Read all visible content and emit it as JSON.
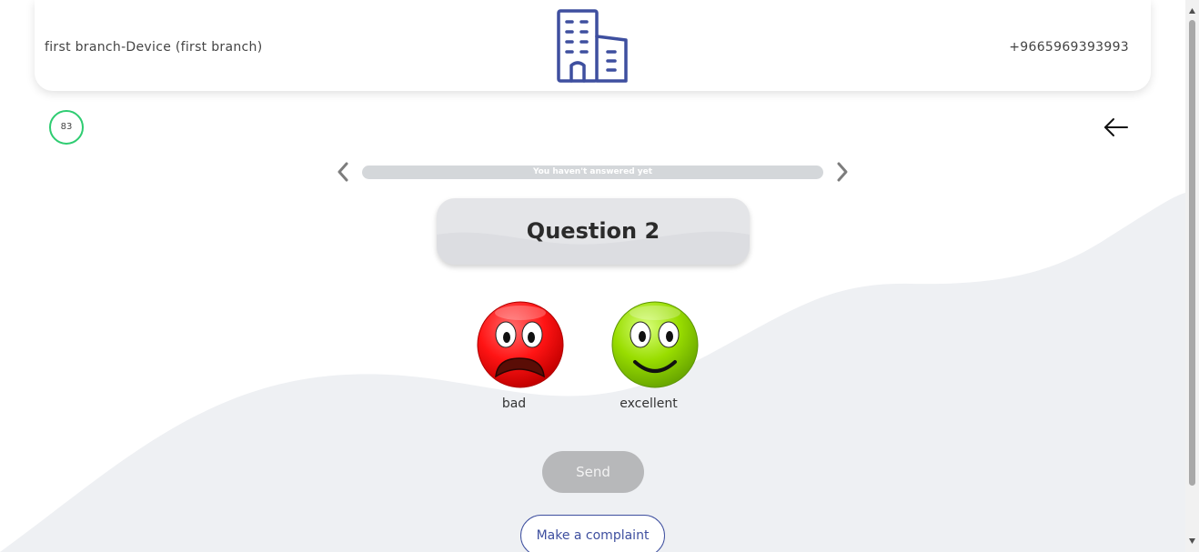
{
  "header": {
    "branch_name": "first branch-Device (first branch)",
    "phone": "+9665969393993",
    "logo_icon": "building-icon",
    "logo_color": "#3e4f9f"
  },
  "timer": {
    "value": "83",
    "ring_color": "#2ecc71",
    "progress": 1.0
  },
  "navigation": {
    "back_icon": "arrow-left-icon",
    "prev_icon": "chevron-left-icon",
    "next_icon": "chevron-right-icon"
  },
  "progress": {
    "text": "You haven't answered yet",
    "fraction": 0
  },
  "question": {
    "title": "Question 2"
  },
  "answers": [
    {
      "label": "bad",
      "icon": "sad-face-icon",
      "color": "#ff1a1a"
    },
    {
      "label": "excellent",
      "icon": "smile-face-icon",
      "color": "#8fd400"
    }
  ],
  "actions": {
    "send_label": "Send",
    "complaint_label": "Make a complaint"
  },
  "colors": {
    "accent": "#3e4f9f",
    "button_disabled": "#b7b8ba",
    "wave_background": "#eef0f3"
  }
}
